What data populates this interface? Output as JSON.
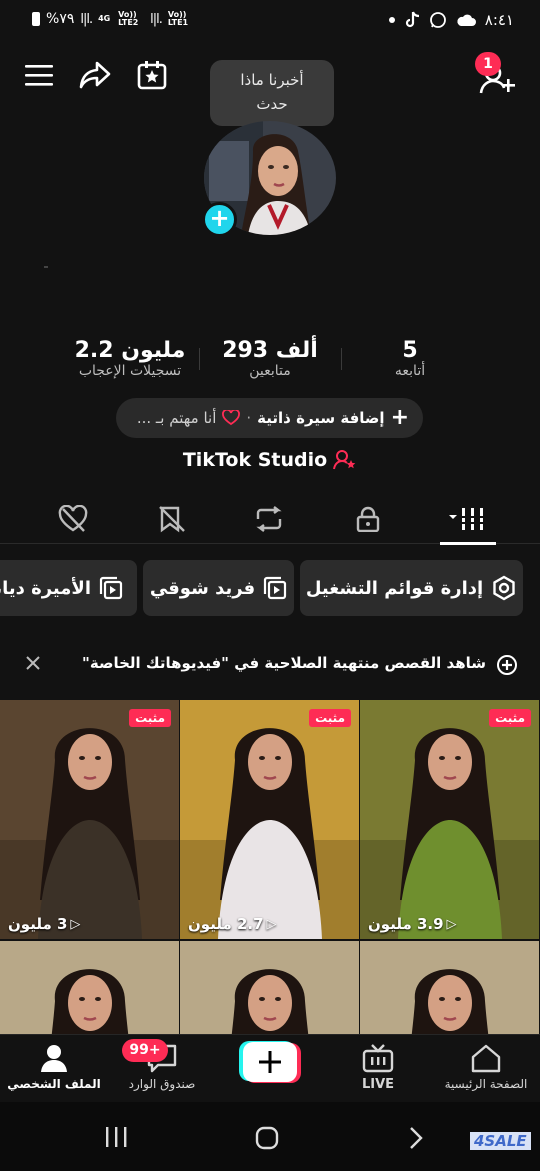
{
  "status_bar": {
    "battery": "%٧٩",
    "lte_1": "Vo)) LTE2",
    "lte_2": "Vo)) LTE1",
    "net_4g": "4G",
    "time": "٨:٤١"
  },
  "header": {
    "notification_count": "1",
    "tooltip": {
      "line1": "أخبرنا ماذا",
      "line2": "حدث"
    }
  },
  "stats": [
    {
      "value": "5",
      "label": "أتابعه"
    },
    {
      "value": "293 ألف",
      "label": "متابعين"
    },
    {
      "value": "2.2 مليون",
      "label": "تسجيلات الإعجاب"
    }
  ],
  "bio": {
    "add_bio": "إضافة سيرة ذاتية",
    "separator": "·",
    "interest": "أنا مهتم بـ ..."
  },
  "studio_label": "TikTok Studio",
  "tabs": [
    {
      "name": "videos",
      "icon": "grid-icon"
    },
    {
      "name": "private",
      "icon": "lock-icon"
    },
    {
      "name": "reposts",
      "icon": "repost-icon"
    },
    {
      "name": "favorites",
      "icon": "bookmark-icon"
    },
    {
      "name": "liked",
      "icon": "heart-icon"
    }
  ],
  "playlists": {
    "manage": "إدارة قوائم التشغيل",
    "items": [
      "فريد شوقي",
      "الأميرة ديانا"
    ]
  },
  "notice": "شاهد القصص منتهية الصلاحية في \"فيديوهاتك الخاصة\"",
  "videos": [
    {
      "pinned": "مثبت",
      "views": "3.9 مليون",
      "bg": "#7a7a32",
      "dress": "#6f8f2e"
    },
    {
      "pinned": "مثبت",
      "views": "2.7 مليون",
      "bg": "#c59a38",
      "dress": "#e9e4e6"
    },
    {
      "pinned": "مثبت",
      "views": "3 مليون",
      "bg": "#5a4530",
      "dress": "#3b3127"
    },
    {
      "pinned": "",
      "views": "",
      "bg": "#b8a888",
      "dress": "#1c1c1c"
    },
    {
      "pinned": "",
      "views": "",
      "bg": "#b8a888",
      "dress": "#1c1c1c"
    },
    {
      "pinned": "",
      "views": "",
      "bg": "#b8a888",
      "dress": "#1c1c1c"
    }
  ],
  "bottom_nav": {
    "home": "الصفحة الرئيسية",
    "live": "LIVE",
    "inbox": "صندوق الوارد",
    "inbox_badge": "99+",
    "profile": "الملف الشخصي"
  },
  "watermark": "4SALE",
  "colors": {
    "accent": "#fe2c55",
    "cyan": "#20d5ec",
    "background": "#121212"
  }
}
